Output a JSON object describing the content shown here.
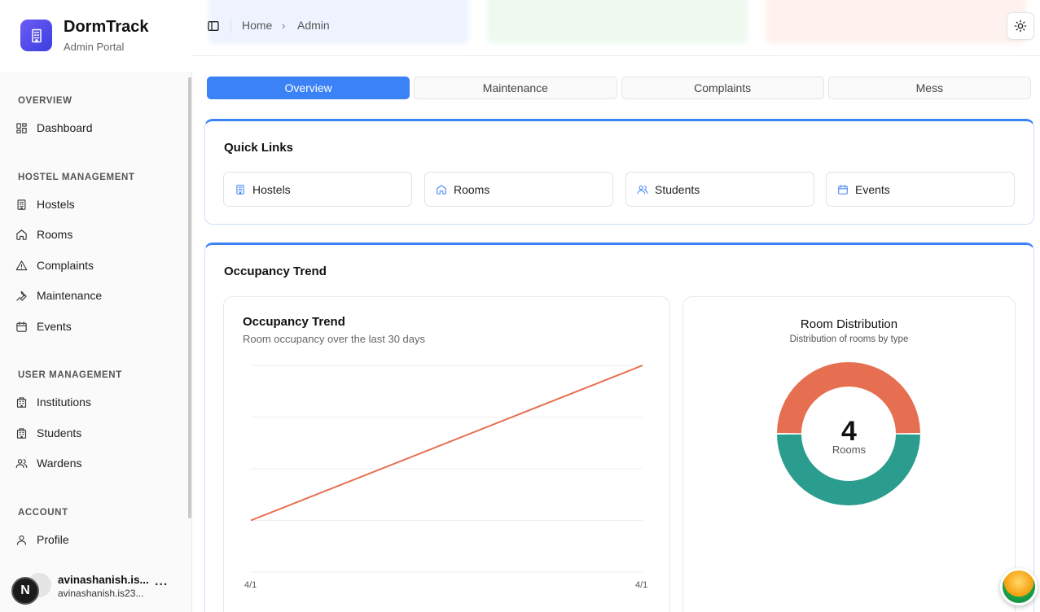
{
  "brand": {
    "title": "DormTrack",
    "subtitle": "Admin Portal",
    "logo_icon": "building-icon"
  },
  "sidebar": {
    "sections": [
      {
        "label": "OVERVIEW",
        "items": [
          {
            "label": "Dashboard",
            "icon": "dashboard-icon"
          }
        ]
      },
      {
        "label": "HOSTEL MANAGEMENT",
        "items": [
          {
            "label": "Hostels",
            "icon": "building-icon"
          },
          {
            "label": "Rooms",
            "icon": "home-icon"
          },
          {
            "label": "Complaints",
            "icon": "alert-triangle-icon"
          },
          {
            "label": "Maintenance",
            "icon": "wrench-icon"
          },
          {
            "label": "Events",
            "icon": "calendar-icon"
          }
        ]
      },
      {
        "label": "USER MANAGEMENT",
        "items": [
          {
            "label": "Institutions",
            "icon": "institution-icon"
          },
          {
            "label": "Students",
            "icon": "institution-icon"
          },
          {
            "label": "Wardens",
            "icon": "users-icon"
          }
        ]
      },
      {
        "label": "ACCOUNT",
        "items": [
          {
            "label": "Profile",
            "icon": "user-icon"
          }
        ]
      }
    ],
    "user": {
      "name": "avinashanish.is...",
      "email": "avinashanish.is23...",
      "badge": "N",
      "more": "..."
    }
  },
  "breadcrumb": {
    "home": "Home",
    "current": "Admin",
    "separator": "›"
  },
  "tabs": [
    {
      "label": "Overview",
      "active": true
    },
    {
      "label": "Maintenance",
      "active": false
    },
    {
      "label": "Complaints",
      "active": false
    },
    {
      "label": "Mess",
      "active": false
    }
  ],
  "quick_links": {
    "title": "Quick Links",
    "items": [
      {
        "label": "Hostels",
        "icon": "building-icon"
      },
      {
        "label": "Rooms",
        "icon": "home-icon"
      },
      {
        "label": "Students",
        "icon": "users-icon"
      },
      {
        "label": "Events",
        "icon": "calendar-icon"
      }
    ]
  },
  "occupancy_section": {
    "title": "Occupancy Trend"
  },
  "colors": {
    "accent": "#3b82f6",
    "line": "#e76f51",
    "donut_a": "#e76f51",
    "donut_b": "#2a9d8f"
  },
  "chart_data": [
    {
      "type": "line",
      "title": "Occupancy Trend",
      "subtitle": "Room occupancy over the last 30 days",
      "x": [
        "4/1",
        "4/1"
      ],
      "series": [
        {
          "values": [
            25,
            100
          ]
        }
      ],
      "ylim": [
        0,
        100
      ],
      "grid": true,
      "tick_labels": [
        "4/1",
        "4/1"
      ]
    },
    {
      "type": "pie",
      "title": "Room Distribution",
      "subtitle": "Distribution of rooms by type",
      "slices": [
        {
          "value": 2
        },
        {
          "value": 2
        }
      ],
      "center_value": "4",
      "center_label": "Rooms"
    }
  ]
}
